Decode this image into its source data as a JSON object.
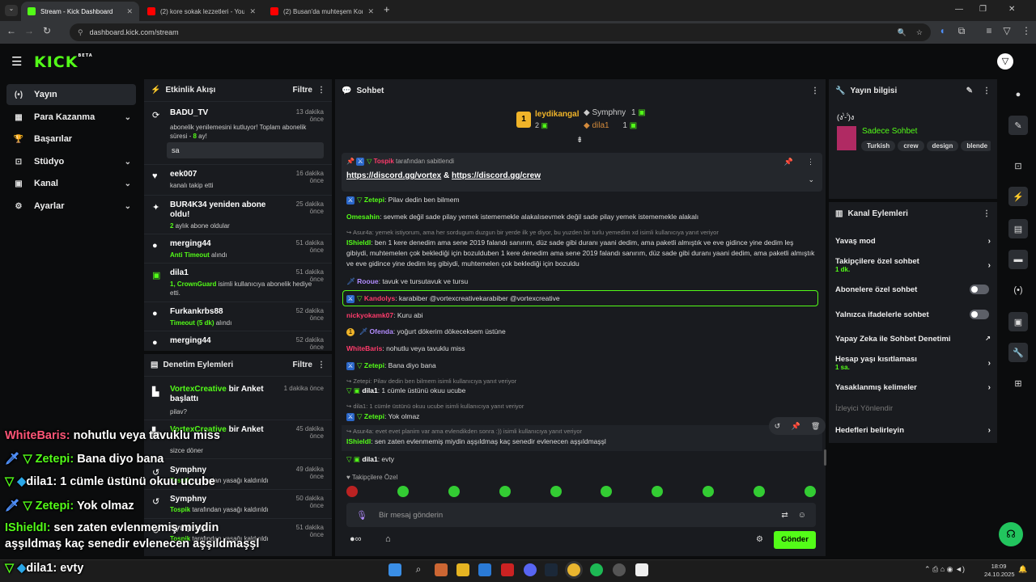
{
  "browser": {
    "tabs": [
      {
        "title": "Stream - Kick Dashboard",
        "active": true
      },
      {
        "title": "(2) kore sokak lezzetleri - YouTube",
        "active": false
      },
      {
        "title": "(2) Busan'da muhteşem Kore s...",
        "active": false
      }
    ],
    "new_tab": "+",
    "url": "dashboard.kick.com/stream",
    "win_min": "—",
    "win_max": "❐",
    "win_close": "✕"
  },
  "brand": {
    "logo": "KICK",
    "beta": "BETA"
  },
  "sidebar": {
    "items": [
      {
        "label": "Yayın",
        "icon": "(•)",
        "chevron": ""
      },
      {
        "label": "Para Kazanma",
        "icon": "▦",
        "chevron": "⌄"
      },
      {
        "label": "Başarılar",
        "icon": "🏆",
        "chevron": ""
      },
      {
        "label": "Stüdyo",
        "icon": "⊡",
        "chevron": "⌄"
      },
      {
        "label": "Kanal",
        "icon": "▣",
        "chevron": "⌄"
      },
      {
        "label": "Ayarlar",
        "icon": "⚙",
        "chevron": "⌄"
      }
    ]
  },
  "activity": {
    "title": "Etkinlik Akışı",
    "filter": "Filtre",
    "items": [
      {
        "user": "BADU_TV",
        "time": "13 dakika önce",
        "line1": "abonelik yenilemesini kutluyor! Toplam abonelik süresi - ",
        "highlight": "8",
        "line2": " ay!",
        "message": "sa"
      },
      {
        "user": "eek007",
        "time": "16 dakika önce",
        "desc": "kanalı takip etti"
      },
      {
        "user": "BUR4K34 yeniden abone oldu!",
        "time": "25 dakika önce",
        "highlight": "2",
        "desc": " aylık abone oldular"
      },
      {
        "user": "merging44",
        "time": "51 dakika önce",
        "highlight": "Anti Timeout",
        "desc": " alındı"
      },
      {
        "user": "dila1",
        "time": "51 dakika önce",
        "highlight": "1, CrownGuard",
        "desc": " isimli kullanıcıya abonelik hediye etti."
      },
      {
        "user": "Furkankrbs88",
        "time": "52 dakika önce",
        "highlight": "Timeout (5 dk)",
        "desc": " alındı"
      },
      {
        "user": "merging44",
        "time": "52 dakika önce"
      }
    ]
  },
  "moderation": {
    "title": "Denetim Eylemleri",
    "filter": "Filtre",
    "items": [
      {
        "user": "VortexCreative",
        "action": " bir Anket başlattı",
        "time": "1 dakika önce",
        "desc": "pilav?"
      },
      {
        "user": "VortexCreative",
        "action": " bir Anket",
        "time": "45 dakika önce",
        "desc": "sizce döner"
      },
      {
        "user": "Symphny",
        "time": "49 dakika önce",
        "by": "Tospik",
        "desc": " tarafından yasağı kaldırıldı"
      },
      {
        "user": "Symphny",
        "time": "50 dakika önce",
        "by": "Tospik",
        "desc": " tarafından yasağı kaldırıldı"
      },
      {
        "user": "Symphny",
        "time": "51 dakika önce",
        "by": "Tospik",
        "desc": " tarafından yasağı kaldırıldı"
      }
    ]
  },
  "chat": {
    "title": "Sohbet",
    "leaderboard": {
      "first": {
        "rank": "1",
        "user": "leydikangal",
        "count": "2"
      },
      "second": {
        "user": "Symphny",
        "count": "1"
      },
      "third": {
        "user": "dila1",
        "count": "1"
      }
    },
    "pinned_by_user": "Tospik",
    "pinned_by_text": " tarafından sabitlendi",
    "pinned_link1": "https://discord.gg/vortex",
    "pinned_amp": " & ",
    "pinned_link2": "https://discord.gg/crew",
    "messages": [
      {
        "user": "Zetepi",
        "text": ": Pilav dedin ben bilmem",
        "color": "#53fc18"
      },
      {
        "user": "Omesahin",
        "text": ": sevmek değil sade pilay yemek istememekle alakalısevmek değil sade pilay yemek istememekle alakalı",
        "color": "#53fc18"
      },
      {
        "reply": "Asur4a: yemek istiyorum, ama her sordugum duzgun bir yerde ilk ye diyor, bu yuzden bir turlu yemedim xd isimli kullanıcıya yanıt veriyor"
      },
      {
        "user": "IShieldI",
        "text": ": ben 1 kere denedim ama sene 2019 falandı sanırım, düz sade gibi duranı yaani dedim, ama paketli almıştık ve eve gidince yine dedim leş gibiydi, muhtemelen çok beklediği için bozulduben 1 kere denedim ama sene 2019 falandı sanırım, düz sade gibi duranı yaani dedim, ama paketli almıştık ve eve gidince yine dedim leş gibiydi, muhtemelen çok beklediği için bozuldu",
        "color": "#53fc18"
      },
      {
        "user": "Rooue",
        "text": ": tavuk ve tursutavuk ve tursu",
        "color": "#b38cff"
      },
      {
        "user": "Kandolys",
        "text": ": karabiber @vortexcreativekarabiber @vortexcreative",
        "color": "#ff3b6b"
      },
      {
        "user": "nickyokamk07",
        "text": ": Kuru abi",
        "color": "#ff3b6b"
      },
      {
        "user": "Ofenda",
        "text": ": yoğurt dökerim dökecek​sem üstüne",
        "color": "#b38cff"
      },
      {
        "user": "WhiteBaris",
        "text": ": nohutlu veya tavuklu miss",
        "color": "#ff3b6b"
      },
      {
        "user": "Zetepi",
        "text": ": Bana diyo bana",
        "color": "#53fc18"
      },
      {
        "reply": "Zetepi: Pilav dedin ben bilmem isimli kullanıcıya yanıt veriyor"
      },
      {
        "user": "dila1",
        "text": ": 1 cümle üstünü okuu ucube",
        "color": "#ffffff"
      },
      {
        "reply": "dila1: 1 cümle üstünü okuu ucube isimli kullanıcıya yanıt veriyor"
      },
      {
        "user": "Zetepi",
        "text": ": Yok olmaz",
        "color": "#53fc18"
      },
      {
        "reply": "Asur4a: evet evet planim var ama evlendikden sonra :)) isimli kullanıcıya yanıt veriyor"
      },
      {
        "user": "IShieldI",
        "text": ": sen zaten evlenmemiş miydin aşşıldmaş kaç senedir evlenecen aşşıldmaşşl",
        "color": "#53fc18"
      },
      {
        "user": "dila1",
        "text": ": evty",
        "color": "#ffffff"
      }
    ],
    "followers_only": "Takipçilere Özel",
    "input_placeholder": "Bir mesaj gönderin",
    "send": "Gönder"
  },
  "stream_info": {
    "title": "Yayın bilgisi",
    "kaomoji": "(ง'̀-'́)ง",
    "category": "Sadece Sohbet",
    "tags": [
      "Turkish",
      "crew",
      "design",
      "blende"
    ]
  },
  "channel_actions": {
    "title": "Kanal Eylemleri",
    "items": [
      {
        "label": "Yavaş mod",
        "type": "chevron"
      },
      {
        "label": "Takipçilere özel sohbet",
        "sub": "1 dk.",
        "type": "chevron"
      },
      {
        "label": "Abonelere özel sohbet",
        "type": "toggle"
      },
      {
        "label": "Yalnızca ifadelerle sohbet",
        "type": "toggle"
      },
      {
        "label": "Yapay Zeka ile Sohbet Denetimi",
        "type": "external"
      },
      {
        "label": "Hesap yaşı kısıtlaması",
        "sub": "1 sa.",
        "type": "chevron"
      },
      {
        "label": "Yasaklanmış kelimeler",
        "type": "chevron"
      },
      {
        "label": "İzleyici Yönlendir",
        "type": "disabled"
      },
      {
        "label": "Hedefleri belirleyin",
        "type": "chevron"
      }
    ]
  },
  "overlay": {
    "lines": [
      {
        "user": "WhiteBaris:",
        "text": " nohutlu veya tavuklu miss",
        "color": "#ff5577"
      },
      {
        "user": "Zetepi:",
        "text": " Bana diyo bana",
        "color": "#53fc18"
      },
      {
        "user": "dila1:",
        "text": " 1 cümle üstünü okuu ucube",
        "color": "#ffffff"
      },
      {
        "user": "Zetepi:",
        "text": " Yok olmaz",
        "color": "#53fc18"
      },
      {
        "user": "IShieldI:",
        "text": " sen zaten evlenmemiş miydin",
        "color": "#53fc18"
      },
      {
        "user": "",
        "text": "aşşıldmaş kaç senedir evlenecen aşşıldmaşşl",
        "color": "#ffffff"
      },
      {
        "user": "dila1:",
        "text": " evty",
        "color": "#ffffff"
      }
    ]
  },
  "taskbar": {
    "time": "18:09",
    "date": "24.10.2025"
  }
}
